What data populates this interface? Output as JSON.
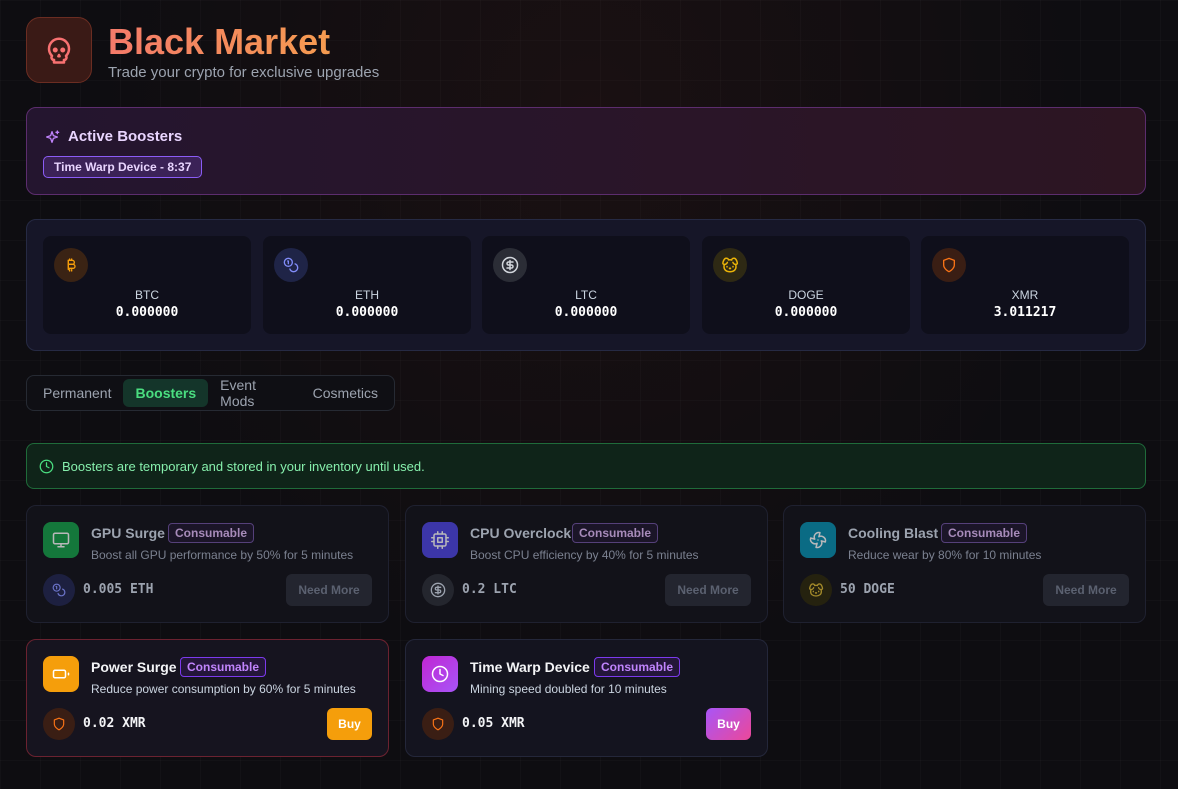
{
  "header": {
    "title": "Black Market",
    "subtitle": "Trade your crypto for exclusive upgrades",
    "logo_icon": "skull-icon"
  },
  "active_boosters": {
    "title": "Active Boosters",
    "items": [
      "Time Warp Device - 8:37"
    ]
  },
  "wallet": [
    {
      "symbol": "BTC",
      "amount": "0.000000",
      "icon": "bitcoin-icon",
      "color": "#f59e0b"
    },
    {
      "symbol": "ETH",
      "amount": "0.000000",
      "icon": "coins-icon",
      "color": "#818cf8"
    },
    {
      "symbol": "LTC",
      "amount": "0.000000",
      "icon": "dollar-circle-icon",
      "color": "#d1d5db"
    },
    {
      "symbol": "DOGE",
      "amount": "0.000000",
      "icon": "dog-icon",
      "color": "#eab308"
    },
    {
      "symbol": "XMR",
      "amount": "3.011217",
      "icon": "shield-icon",
      "color": "#f97316"
    }
  ],
  "tabs": [
    {
      "label": "Permanent",
      "active": false
    },
    {
      "label": "Boosters",
      "active": true
    },
    {
      "label": "Event Mods",
      "active": false
    },
    {
      "label": "Cosmetics",
      "active": false
    }
  ],
  "info_banner": "Boosters are temporary and stored in your inventory until used.",
  "products": [
    {
      "name": "GPU Surge",
      "tag": "Consumable",
      "description": "Boost all GPU performance by 50% for 5 minutes",
      "price": "0.005 ETH",
      "button": "Need More",
      "affordable": false,
      "icon": "monitor-icon",
      "icon_color": "#16a34a"
    },
    {
      "name": "CPU Overclock",
      "tag": "Consumable",
      "description": "Boost CPU efficiency by 40% for 5 minutes",
      "price": "0.2 LTC",
      "button": "Need More",
      "affordable": false,
      "icon": "cpu-icon",
      "icon_color": "#4f46e5"
    },
    {
      "name": "Cooling Blast",
      "tag": "Consumable",
      "description": "Reduce wear by 80% for 10 minutes",
      "price": "50 DOGE",
      "button": "Need More",
      "affordable": false,
      "icon": "fan-icon",
      "icon_color": "#0891b2"
    },
    {
      "name": "Power Surge",
      "tag": "Consumable",
      "description": "Reduce power consumption by 60% for 5 minutes",
      "price": "0.02 XMR",
      "button": "Buy",
      "affordable": true,
      "icon": "battery-icon",
      "icon_color": "#f59e0b"
    },
    {
      "name": "Time Warp Device",
      "tag": "Consumable",
      "description": "Mining speed doubled for 10 minutes",
      "price": "0.05 XMR",
      "button": "Buy",
      "affordable": true,
      "icon": "clock-icon",
      "icon_color": "#c026d3"
    }
  ]
}
